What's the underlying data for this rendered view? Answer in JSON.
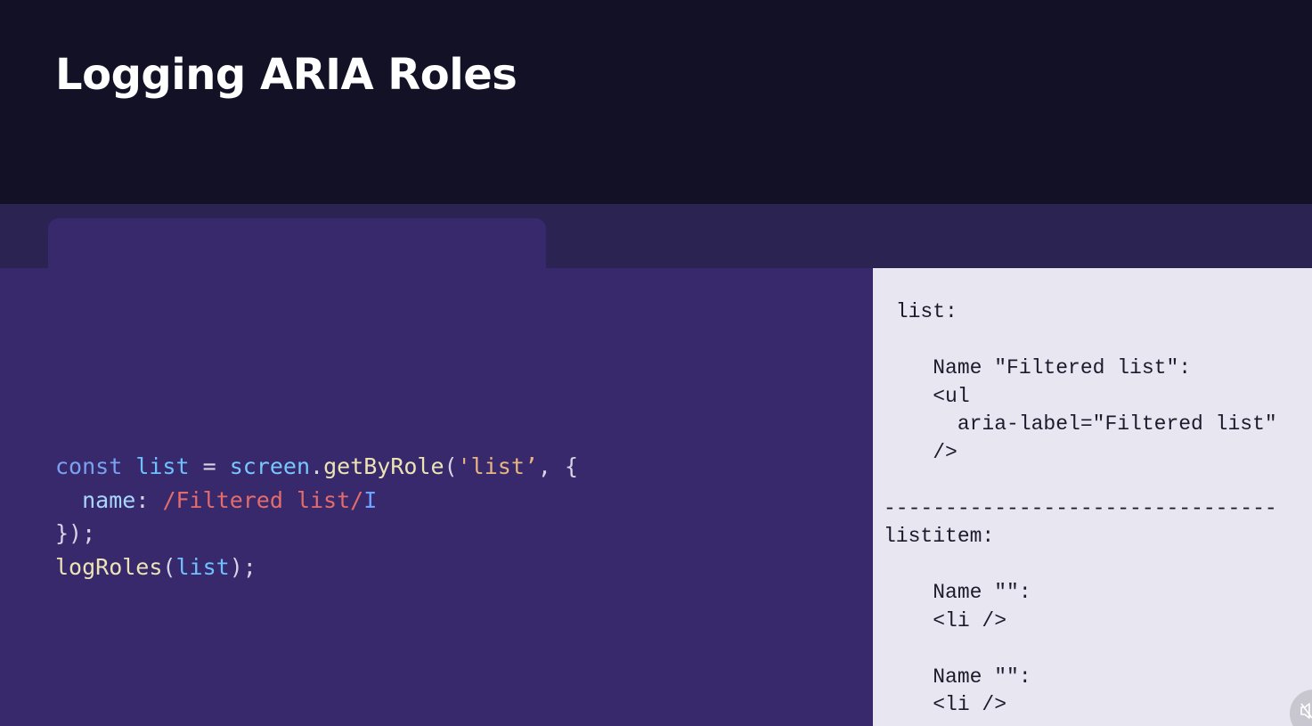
{
  "slide": {
    "title": "Logging ARIA Roles"
  },
  "code": {
    "line1": {
      "kw_const": "const",
      "var_list": "list",
      "eq": " = ",
      "obj_screen": "screen",
      "dot": ".",
      "fn_getByRole": "getByRole",
      "paren_open": "(",
      "str_list": "'list’",
      "tail": ", {"
    },
    "line2": {
      "indent": "  ",
      "prop_name": "name",
      "colon": ": ",
      "regex": "/Filtered list/",
      "flag": "I"
    },
    "line3": {
      "text": "});"
    },
    "line4": {
      "fn_logRoles": "logRoles",
      "paren_open": "(",
      "var_list": "list",
      "tail": ");"
    }
  },
  "output": {
    "lines": [
      " list:",
      "",
      "    Name \"Filtered list\":",
      "    <ul",
      "      aria-label=\"Filtered list\"",
      "    />",
      "",
      "--------------------------------",
      "listitem:",
      "",
      "    Name \"\":",
      "    <li />",
      "",
      "    Name \"\":",
      "    <li />"
    ]
  },
  "colors": {
    "header_bg": "#131125",
    "strip_bg": "#2b2352",
    "code_bg": "#37296b",
    "output_bg": "#e8e6f1",
    "title_text": "#ffffff"
  },
  "icons": {
    "corner_badge": "speaker-muted-icon"
  }
}
